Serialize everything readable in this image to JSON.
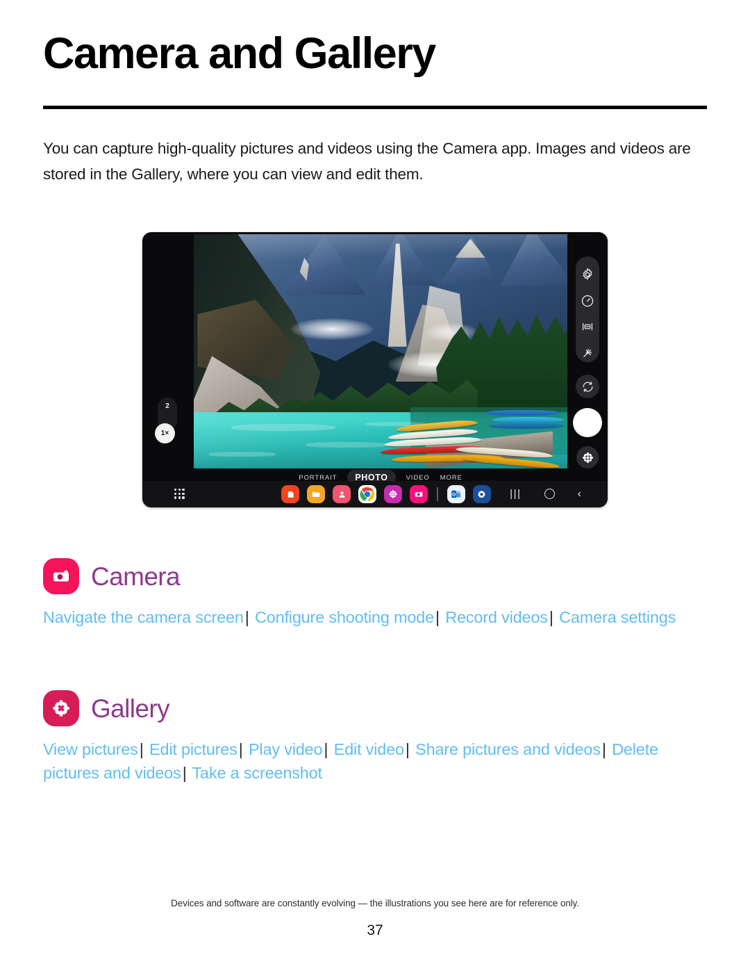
{
  "page": {
    "title": "Camera and Gallery",
    "intro": "You can capture high-quality pictures and videos using the Camera app. Images and videos are stored in the Gallery, where you can view and edit them.",
    "footer_note": "Devices and software are constantly evolving — the illustrations you see here are for reference only.",
    "page_number": "37"
  },
  "illustration": {
    "device": "samsung-tablet-camera-preview",
    "zoom": {
      "secondary_label": "2",
      "active_label": "1×"
    },
    "right_controls": [
      {
        "name": "settings-icon",
        "label": "Settings"
      },
      {
        "name": "timer-icon",
        "label": "Timer"
      },
      {
        "name": "aspect-ratio-icon",
        "label": "Aspect ratio"
      },
      {
        "name": "effects-icon",
        "label": "Effects"
      },
      {
        "name": "switch-camera-icon",
        "label": "Switch camera"
      },
      {
        "name": "shutter-button",
        "label": "Shutter"
      },
      {
        "name": "gallery-preview-icon",
        "label": "Gallery"
      }
    ],
    "modes": [
      {
        "label": "PORTRAIT",
        "active": false
      },
      {
        "label": "PHOTO",
        "active": true
      },
      {
        "label": "VIDEO",
        "active": false
      },
      {
        "label": "MORE",
        "active": false
      }
    ],
    "taskbar": {
      "apps_button": "apps-grid-icon",
      "icons": [
        {
          "name": "samsung-notes-icon",
          "color": "#f2441d"
        },
        {
          "name": "my-files-icon",
          "color": "#f5a623"
        },
        {
          "name": "contacts-icon",
          "color": "#f2546b"
        },
        {
          "name": "chrome-icon",
          "color": "#ffffff"
        },
        {
          "name": "gallery-icon",
          "color": "#c82bb0"
        },
        {
          "name": "camera-icon",
          "color": "#f5127b"
        },
        {
          "name": "outlook-icon",
          "color": "#eaf2fb"
        },
        {
          "name": "settings-icon",
          "color": "#1b4f9c"
        }
      ],
      "nav": [
        {
          "name": "recents-key",
          "glyph": "|||"
        },
        {
          "name": "home-key",
          "glyph": "○"
        },
        {
          "name": "back-key",
          "glyph": "‹"
        }
      ]
    }
  },
  "sections": [
    {
      "id": "camera",
      "name": "Camera",
      "icon": "camera-app-icon",
      "accent": "#f5145b",
      "links": [
        "Navigate the camera screen",
        "Configure shooting mode",
        "Record videos",
        "Camera settings"
      ]
    },
    {
      "id": "gallery",
      "name": "Gallery",
      "icon": "gallery-app-icon",
      "accent": "#d61d55",
      "links": [
        "View pictures",
        "Edit pictures",
        "Play video",
        "Edit video",
        "Share pictures and videos",
        "Delete pictures and videos",
        "Take a screenshot"
      ]
    }
  ],
  "colors": {
    "link": "#62bdf2",
    "heading": "#8e3a8e",
    "rule": "#000000"
  }
}
